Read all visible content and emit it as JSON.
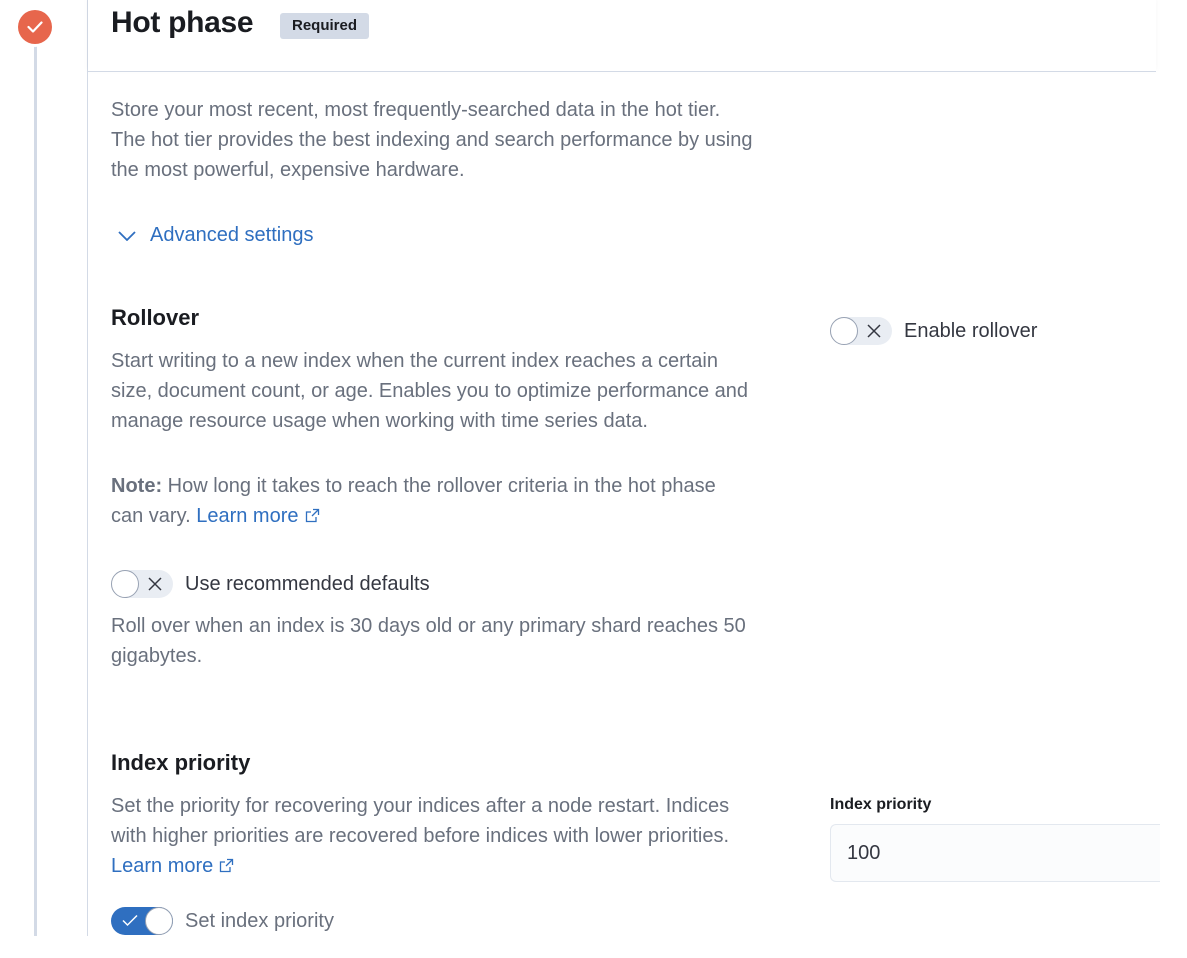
{
  "phase": {
    "title": "Hot phase",
    "badge": "Required",
    "status_color": "#e7664c",
    "description_lines": [
      "Store your most recent, most frequently-searched data in the hot tier.",
      "The hot tier provides the best indexing and search performance by using",
      "the most powerful, expensive hardware."
    ],
    "advanced_settings_label": "Advanced settings"
  },
  "rollover": {
    "title": "Rollover",
    "description_lines": [
      "Start writing to a new index when the current index reaches a certain",
      "size, document count, or age. Enables you to optimize performance and",
      "manage resource usage when working with time series data."
    ],
    "note_label": "Note:",
    "note_text_line1": " How long it takes to reach the rollover criteria in the hot phase",
    "note_text_line2": "can vary. ",
    "learn_more": "Learn more",
    "enable_toggle": {
      "label": "Enable rollover",
      "checked": false
    },
    "defaults_toggle": {
      "label": "Use recommended defaults",
      "checked": false
    },
    "defaults_help_lines": [
      "Roll over when an index is 30 days old or any primary shard reaches 50",
      "gigabytes."
    ]
  },
  "index_priority": {
    "title": "Index priority",
    "description_lines": [
      "Set the priority for recovering your indices after a node restart. Indices",
      "with higher priorities are recovered before indices with lower priorities."
    ],
    "learn_more": "Learn more",
    "toggle": {
      "label": "Set index priority",
      "checked": true
    },
    "field_label": "Index priority",
    "field_value": "100"
  },
  "colors": {
    "accent": "#2f6fc0",
    "text_subdued": "#69707d",
    "border": "#d3dae6"
  }
}
